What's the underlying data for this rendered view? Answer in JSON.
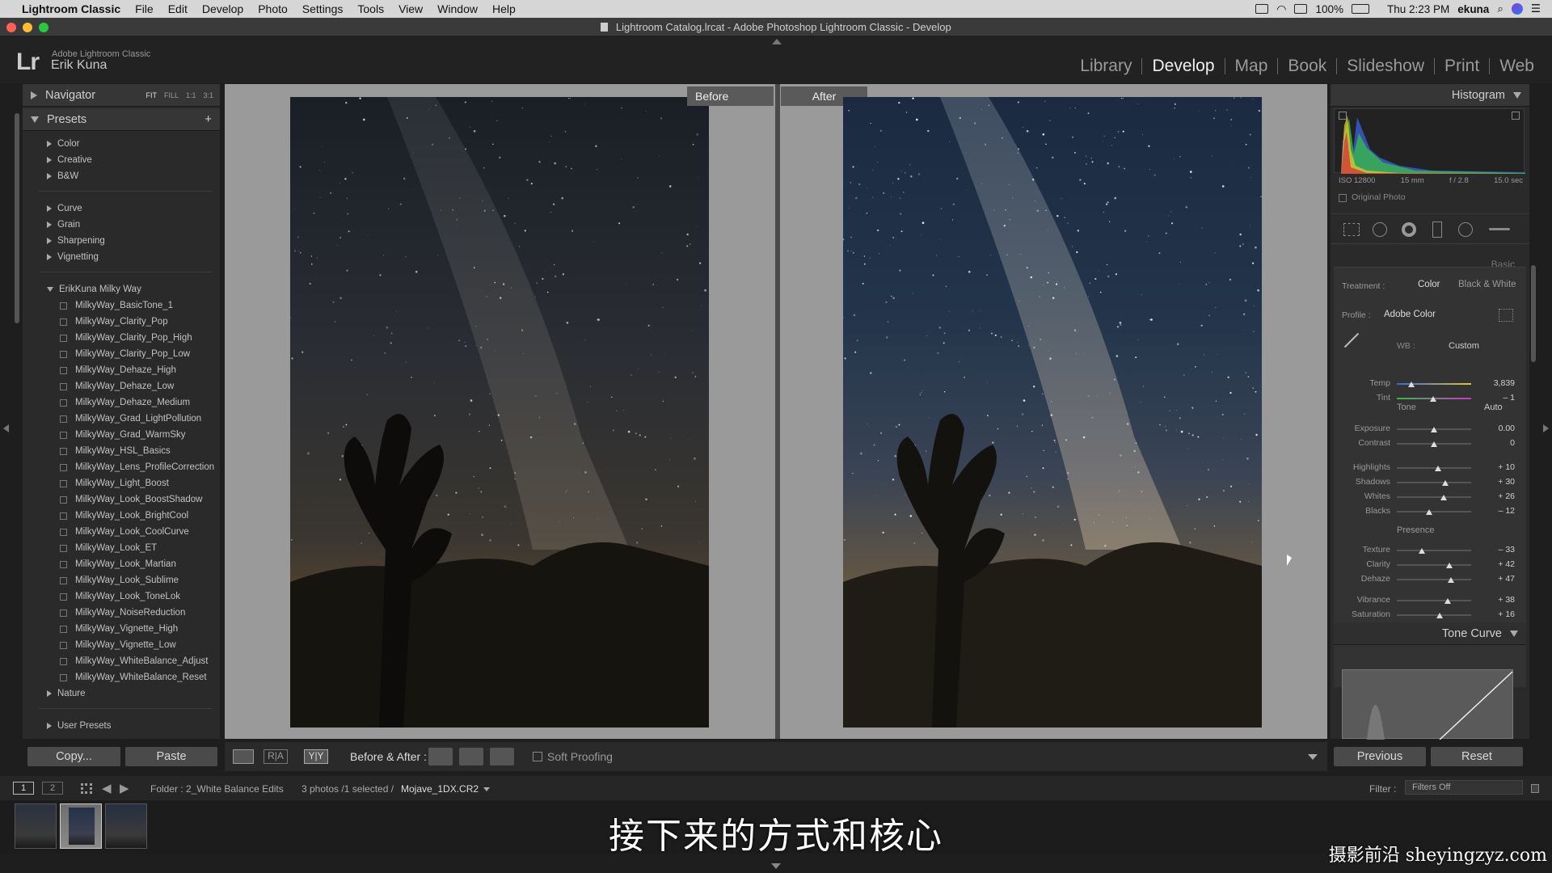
{
  "menubar": {
    "app": "Lightroom Classic",
    "items": [
      "File",
      "Edit",
      "Develop",
      "Photo",
      "Settings",
      "Tools",
      "View",
      "Window",
      "Help"
    ],
    "battery": "100%",
    "clock": "Thu 2:23 PM",
    "user": "ekuna"
  },
  "window": {
    "title": "Lightroom Catalog.lrcat - Adobe Photoshop Lightroom Classic - Develop"
  },
  "identity": {
    "logo": "Lr",
    "product": "Adobe Lightroom Classic",
    "name": "Erik Kuna"
  },
  "modules": [
    "Library",
    "Develop",
    "Map",
    "Book",
    "Slideshow",
    "Print",
    "Web"
  ],
  "active_module": "Develop",
  "left": {
    "navigator": "Navigator",
    "nav_opts": [
      "FIT",
      "FILL",
      "1:1",
      "3:1"
    ],
    "presets": "Presets",
    "groups": [
      "Color",
      "Creative",
      "B&W",
      "Curve",
      "Grain",
      "Sharpening",
      "Vignetting"
    ],
    "folder": "ErikKuna Milky Way",
    "items": [
      "MilkyWay_BasicTone_1",
      "MilkyWay_Clarity_Pop",
      "MilkyWay_Clarity_Pop_High",
      "MilkyWay_Clarity_Pop_Low",
      "MilkyWay_Dehaze_High",
      "MilkyWay_Dehaze_Low",
      "MilkyWay_Dehaze_Medium",
      "MilkyWay_Grad_LightPollution",
      "MilkyWay_Grad_WarmSky",
      "MilkyWay_HSL_Basics",
      "MilkyWay_Lens_ProfileCorrection",
      "MilkyWay_Light_Boost",
      "MilkyWay_Look_BoostShadow",
      "MilkyWay_Look_BrightCool",
      "MilkyWay_Look_CoolCurve",
      "MilkyWay_Look_ET",
      "MilkyWay_Look_Martian",
      "MilkyWay_Look_Sublime",
      "MilkyWay_Look_ToneLok",
      "MilkyWay_NoiseReduction",
      "MilkyWay_Vignette_High",
      "MilkyWay_Vignette_Low",
      "MilkyWay_WhiteBalance_Adjust",
      "MilkyWay_WhiteBalance_Reset"
    ],
    "nature": "Nature",
    "user_presets": "User Presets",
    "copy": "Copy...",
    "paste": "Paste"
  },
  "center": {
    "before": "Before",
    "after": "After"
  },
  "toolbar": {
    "ba_label": "Before & After :",
    "soft_proof": "Soft Proofing"
  },
  "right": {
    "histogram": "Histogram",
    "exif": [
      "ISO 12800",
      "15 mm",
      "f / 2.8",
      "15.0 sec"
    ],
    "original_photo": "Original Photo",
    "basic": "Basic",
    "treatment_label": "Treatment :",
    "treatment_color": "Color",
    "treatment_bw": "Black & White",
    "profile_label": "Profile :",
    "profile_value": "Adobe Color",
    "wb_label": "WB :",
    "wb_value": "Custom",
    "tone": "Tone",
    "auto": "Auto",
    "presence": "Presence",
    "tone_curve": "Tone Curve",
    "previous": "Previous",
    "reset": "Reset",
    "sliders": [
      {
        "label": "Temp",
        "value": "3,839",
        "pos": 0.2
      },
      {
        "label": "Tint",
        "value": "– 1",
        "pos": 0.49
      },
      {
        "label": "Exposure",
        "value": "0.00",
        "pos": 0.5
      },
      {
        "label": "Contrast",
        "value": "0",
        "pos": 0.5
      },
      {
        "label": "Highlights",
        "value": "+ 10",
        "pos": 0.55
      },
      {
        "label": "Shadows",
        "value": "+ 30",
        "pos": 0.65
      },
      {
        "label": "Whites",
        "value": "+ 26",
        "pos": 0.63
      },
      {
        "label": "Blacks",
        "value": "– 12",
        "pos": 0.44
      },
      {
        "label": "Texture",
        "value": "– 33",
        "pos": 0.34
      },
      {
        "label": "Clarity",
        "value": "+ 42",
        "pos": 0.71
      },
      {
        "label": "Dehaze",
        "value": "+ 47",
        "pos": 0.73
      },
      {
        "label": "Vibrance",
        "value": "+ 38",
        "pos": 0.69
      },
      {
        "label": "Saturation",
        "value": "+ 16",
        "pos": 0.58
      }
    ]
  },
  "filmstrip": {
    "folder": "Folder : 2_White Balance Edits",
    "count": "3 photos /1 selected /",
    "file": "Mojave_1DX.CR2",
    "filter_label": "Filter :",
    "filter_value": "Filters Off",
    "pages": [
      "1",
      "2"
    ]
  },
  "subtitle": "接下来的方式和核心",
  "watermark": "摄影前沿 sheyingzyz.com"
}
